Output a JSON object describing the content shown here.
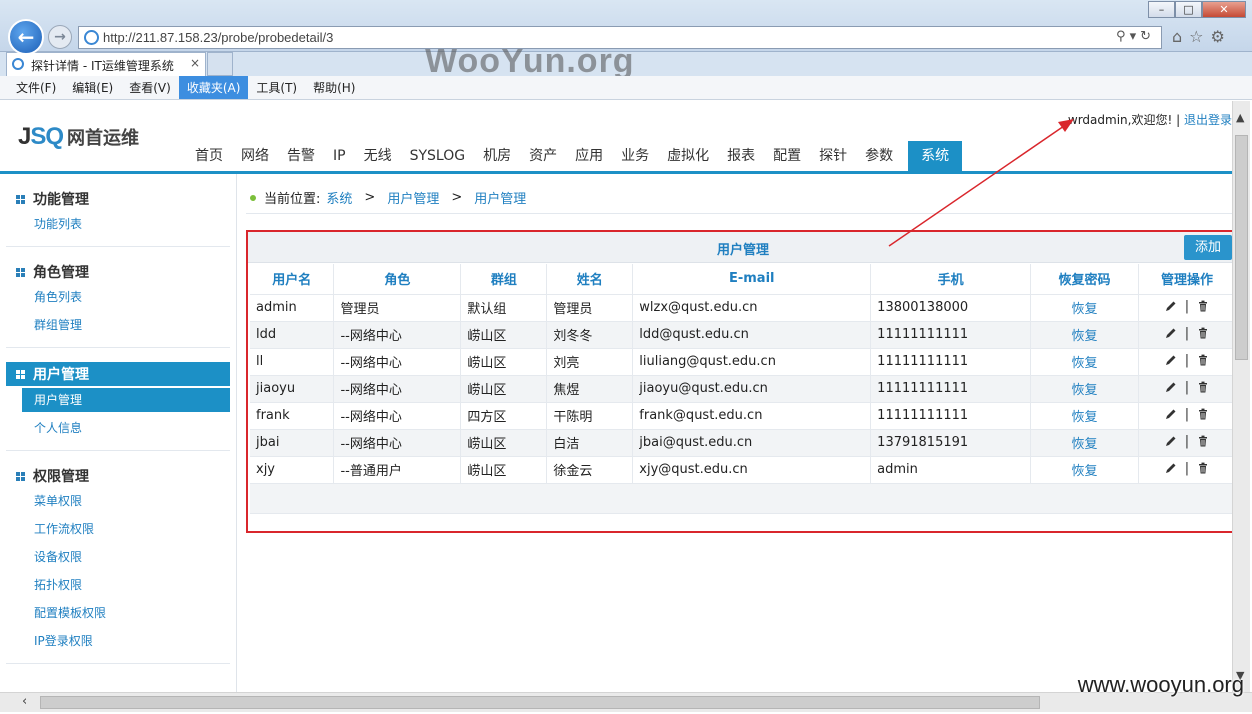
{
  "browser": {
    "url": "http://211.87.158.23/probe/probedetail/3",
    "tab_title": "探针详情 - IT运维管理系统",
    "tab_close": "×",
    "watermark_top": "WooYun.org",
    "menu": [
      "文件(F)",
      "编辑(E)",
      "查看(V)",
      "收藏夹(A)",
      "工具(T)",
      "帮助(H)"
    ],
    "active_menu_index": 3
  },
  "header": {
    "logo_mark_a": "J",
    "logo_mark_b": "SQ",
    "logo_name": "网首运维",
    "welcome": "wrdadmin,欢迎您!",
    "divider": "|",
    "logout": "退出登录",
    "nav": [
      "首页",
      "网络",
      "告警",
      "IP",
      "无线",
      "SYSLOG",
      "机房",
      "资产",
      "应用",
      "业务",
      "虚拟化",
      "报表",
      "配置",
      "探针",
      "参数",
      "系统"
    ],
    "active_nav": "系统"
  },
  "sidebar": {
    "sections": [
      {
        "title": "功能管理",
        "items": [
          "功能列表"
        ]
      },
      {
        "title": "角色管理",
        "items": [
          "角色列表",
          "群组管理"
        ]
      },
      {
        "title": "用户管理",
        "items": [
          "用户管理",
          "个人信息"
        ],
        "active": true
      },
      {
        "title": "权限管理",
        "items": [
          "菜单权限",
          "工作流权限",
          "设备权限",
          "拓扑权限",
          "配置模板权限",
          "IP登录权限"
        ]
      }
    ]
  },
  "breadcrumb": {
    "label": "当前位置:",
    "path": [
      "系统",
      "用户管理",
      "用户管理"
    ],
    "sep": ">"
  },
  "panel": {
    "title": "用户管理",
    "add_label": "添加",
    "columns": [
      "用户名",
      "角色",
      "群组",
      "姓名",
      "E-mail",
      "手机",
      "恢复密码",
      "管理操作"
    ],
    "rows": [
      [
        "admin",
        "管理员",
        "默认组",
        "管理员",
        "wlzx@qust.edu.cn",
        "13800138000",
        "恢复"
      ],
      [
        "ldd",
        "--网络中心",
        "崂山区",
        "刘冬冬",
        "ldd@qust.edu.cn",
        "11111111111",
        "恢复"
      ],
      [
        "ll",
        "--网络中心",
        "崂山区",
        "刘亮",
        "liuliang@qust.edu.cn",
        "11111111111",
        "恢复"
      ],
      [
        "jiaoyu",
        "--网络中心",
        "崂山区",
        "焦煜",
        "jiaoyu@qust.edu.cn",
        "11111111111",
        "恢复"
      ],
      [
        "frank",
        "--网络中心",
        "四方区",
        "干陈明",
        "frank@qust.edu.cn",
        "11111111111",
        "恢复"
      ],
      [
        "jbai",
        "--网络中心",
        "崂山区",
        "白洁",
        "jbai@qust.edu.cn",
        "13791815191",
        "恢复"
      ],
      [
        "xjy",
        "--普通用户",
        "崂山区",
        "徐金云",
        "xjy@qust.edu.cn",
        "admin",
        "恢复"
      ]
    ],
    "ops_sep": "|"
  },
  "watermark_bottom": "www.wooyun.org",
  "colors": {
    "accent": "#1c90c6",
    "highlight": "#d9262c",
    "link": "#1f7fc0"
  }
}
